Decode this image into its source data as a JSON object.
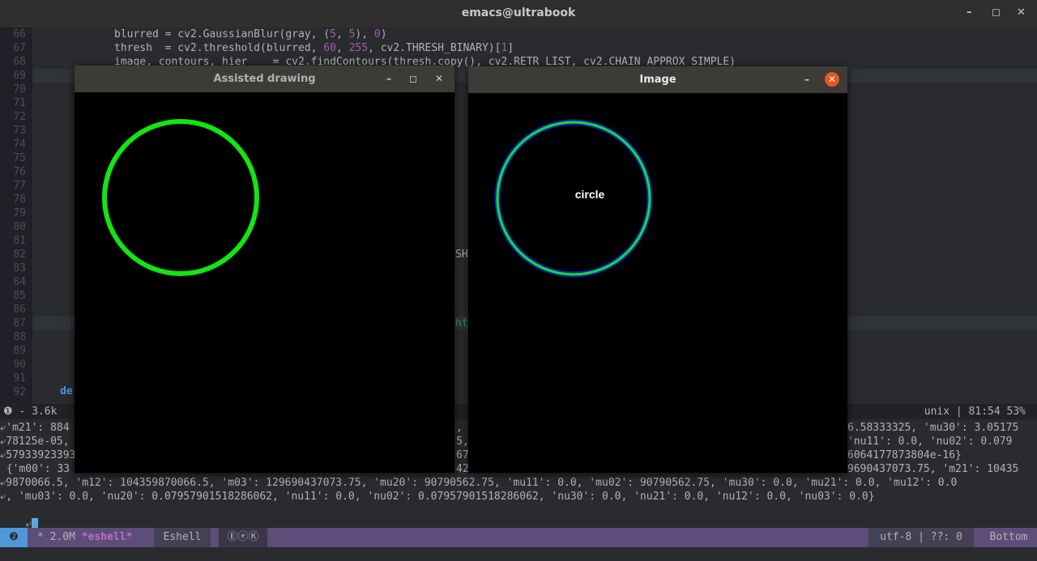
{
  "title": "emacs@ultrabook",
  "window_controls": {
    "min": "–",
    "max": "◻",
    "close": "✕"
  },
  "gutter": [
    "66",
    "67",
    "68",
    "69",
    "70",
    "71",
    "72",
    "73",
    "74",
    "75",
    "76",
    "77",
    "78",
    "79",
    "80",
    "81",
    "82",
    "83",
    "84",
    "85",
    "86",
    "87",
    "88",
    "89",
    "90",
    "91",
    "92"
  ],
  "code": {
    "l66": {
      "a": "blurred = cv2.GaussianBlur(gray, (",
      "n1": "5",
      "b": ", ",
      "n2": "5",
      "c": "), ",
      "n3": "0",
      "d": ")"
    },
    "l67": {
      "a": "thresh  = cv2.threshold(blurred, ",
      "n1": "60",
      "b": ", ",
      "n2": "255",
      "c": ", cv2.THRESH_BINARY)[",
      "n3": "1",
      "d": "]"
    },
    "l68": "image, contours, hier_   = cv2.findContours(thresh.copy(), cv2.RETR_LIST, cv2.CHAIN_APPROX_SIMPLE)",
    "l82_frag": "SH",
    "l87_frag": "ht",
    "l91": "de"
  },
  "modeline_top": {
    "left": " ❶  - 3.6k",
    "right": "unix | 81:54   53% "
  },
  "eshell": {
    "row1_left": "⤶'m21': 884",
    "row1_mid": ",",
    "row1_right": "6.58333325, 'mu30': 3.05175",
    "row2_left": "⤶78125e-05,",
    "row2_mid": "5,",
    "row2_right": "'nu11': 0.0, 'nu02': 0.079",
    "row3_left": "⤶57933923393",
    "row3_mid": "67",
    "row3_right": "6064177873804e-16}",
    "row4_left": " {'m00': 33",
    "row4_mid": "42",
    "row4_right": "9690437073.75, 'm21': 10435",
    "row5": "⤶9870066.5, 'm12': 104359870066.5, 'm03': 129690437073.75, 'mu20': 90790562.75, 'mu11': 0.0, 'mu02': 90790562.75, 'mu30': 0.0, 'mu21': 0.0, 'mu12': 0.0",
    "row6": "⤶, 'mu03': 0.0, 'nu20': 0.07957901518286062, 'nu11': 0.0, 'nu02': 0.07957901518286062, 'nu30': 0.0, 'nu21': 0.0, 'nu12': 0.0, 'nu03': 0.0}",
    "cursor_prefix": "⤶"
  },
  "modeline_bottom": {
    "badge": "❷",
    "buffer_info": "* 2.0M ",
    "buffer_name": "*eshell*",
    "mode": "Eshell",
    "minor": "ⒺⓔⓀ",
    "encoding": "utf-8 | ??: 0",
    "position": "Bottom"
  },
  "assisted_window": {
    "title": "Assisted drawing",
    "min": "–",
    "max": "◻",
    "close": "✕"
  },
  "image_window": {
    "title": "Image",
    "min": "–",
    "close": "✕",
    "label": "circle"
  },
  "colors": {
    "green": "#11e611",
    "blue": "#1420c8",
    "close_orange": "#e95420"
  }
}
